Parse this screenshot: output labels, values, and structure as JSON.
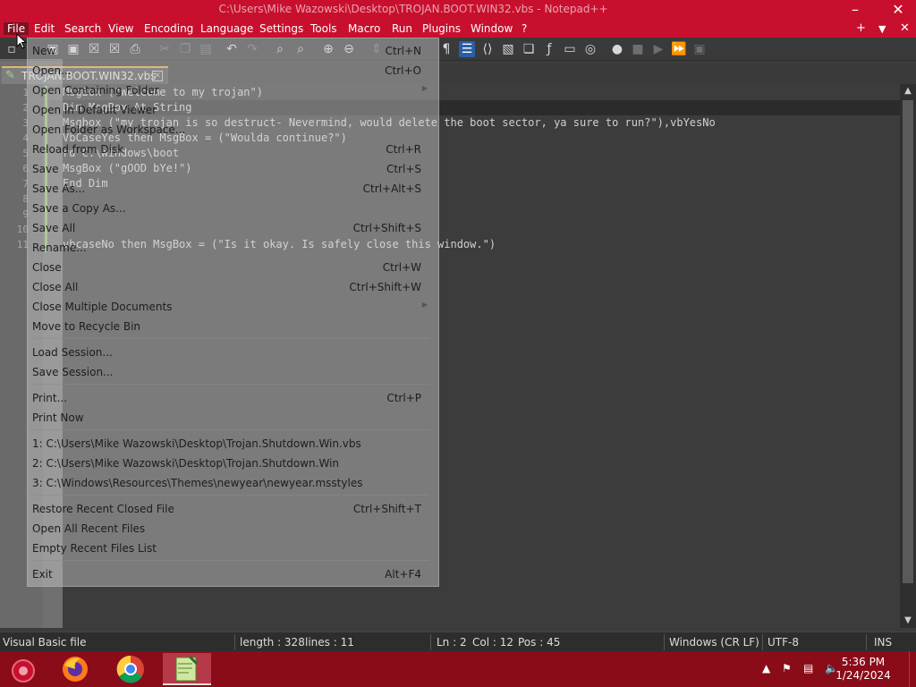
{
  "app": {
    "title": "C:\\Users\\Mike Wazowski\\Desktop\\TROJAN.BOOT.WIN32.vbs - Notepad++"
  },
  "window": {
    "add_symbol": "+",
    "dropdown_symbol": "▼",
    "close_symbol": "✕"
  },
  "menu": [
    "File",
    "Edit",
    "Search",
    "View",
    "Encoding",
    "Language",
    "Settings",
    "Tools",
    "Macro",
    "Run",
    "Plugins",
    "Window",
    "?"
  ],
  "tab": {
    "name": "TROJAN.BOOT.WIN32.vbs",
    "close_symbol": "✕"
  },
  "editor": {
    "line_numbers": [
      "1",
      "2",
      "3",
      "4",
      "5",
      "6",
      "7",
      "8",
      "9",
      "10",
      "11"
    ],
    "lines": [
      "MsgBox (\"Welcome to my trojan\")",
      "Dim MsgBox At String",
      "Msgbox (\"my trojan is so destruct- Nevermind, would delete the boot sector, ya sure to run?\"),vbYesNo",
      "VbCaseYes then MsgBox = (\"Woulda continue?\")",
      "rd C:\\Windows\\boot",
      "MsgBox (\"gOOD bYe!\")",
      "End Dim",
      "",
      "",
      "",
      "vbcaseNo then MsgBox = (\"Is it okay. Is safely close this window.\")"
    ]
  },
  "file_menu": {
    "items": [
      {
        "label": "New",
        "shortcut": "Ctrl+N"
      },
      {
        "label": "Open...",
        "shortcut": "Ctrl+O"
      },
      {
        "label": "Open Containing Folder",
        "shortcut": ""
      },
      {
        "label": "Open in Default Viewer",
        "shortcut": ""
      },
      {
        "label": "Open Folder as Workspace...",
        "shortcut": ""
      },
      {
        "label": "Reload from Disk",
        "shortcut": "Ctrl+R"
      },
      {
        "label": "Save",
        "shortcut": "Ctrl+S"
      },
      {
        "label": "Save As...",
        "shortcut": "Ctrl+Alt+S"
      },
      {
        "label": "Save a Copy As...",
        "shortcut": ""
      },
      {
        "label": "Save All",
        "shortcut": "Ctrl+Shift+S"
      },
      {
        "label": "Rename...",
        "shortcut": ""
      },
      {
        "label": "Close",
        "shortcut": "Ctrl+W"
      },
      {
        "label": "Close All",
        "shortcut": "Ctrl+Shift+W"
      },
      {
        "label": "Close Multiple Documents",
        "shortcut": ""
      },
      {
        "label": "Move to Recycle Bin",
        "shortcut": ""
      },
      {
        "label": "Load Session...",
        "shortcut": ""
      },
      {
        "label": "Save Session...",
        "shortcut": ""
      },
      {
        "label": "Print...",
        "shortcut": "Ctrl+P"
      },
      {
        "label": "Print Now",
        "shortcut": ""
      },
      {
        "label": "1: C:\\Users\\Mike Wazowski\\Desktop\\Trojan.Shutdown.Win.vbs",
        "shortcut": ""
      },
      {
        "label": "2: C:\\Users\\Mike Wazowski\\Desktop\\Trojan.Shutdown.Win",
        "shortcut": ""
      },
      {
        "label": "3: C:\\Windows\\Resources\\Themes\\newyear\\newyear.msstyles",
        "shortcut": ""
      },
      {
        "label": "Restore Recent Closed File",
        "shortcut": "Ctrl+Shift+T"
      },
      {
        "label": "Open All Recent Files",
        "shortcut": ""
      },
      {
        "label": "Empty Recent Files List",
        "shortcut": ""
      },
      {
        "label": "Exit",
        "shortcut": "Alt+F4"
      }
    ]
  },
  "status": {
    "language": "Visual Basic file",
    "length": "length : 328",
    "lines": "lines : 11",
    "ln": "Ln : 2",
    "col": "Col : 12",
    "pos": "Pos : 45",
    "eol": "Windows (CR LF)",
    "encoding": "UTF-8",
    "mode": "INS"
  },
  "taskbar": {
    "time": "5:36 PM",
    "date": "1/24/2024"
  },
  "colors": {
    "accent": "#c8102e",
    "taskbar": "#8a0c19",
    "editor_bg": "#3c3c3c",
    "change_bar": "#70b040"
  }
}
